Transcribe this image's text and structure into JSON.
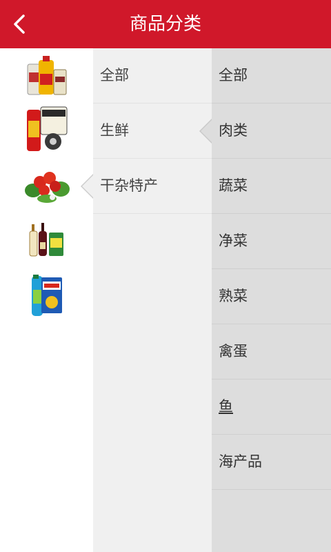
{
  "header": {
    "title": "商品分类",
    "accent": "#d0182a"
  },
  "sidebar": {
    "icons": [
      "oil-rice-products-icon",
      "snacks-drinks-icon",
      "vegetables-icon",
      "liquor-drinks-icon",
      "detergent-products-icon"
    ]
  },
  "middle": {
    "items": [
      {
        "label": "全部"
      },
      {
        "label": "生鲜",
        "selected": true
      },
      {
        "label": "干杂特产"
      }
    ]
  },
  "right": {
    "items": [
      {
        "label": "全部"
      },
      {
        "label": "肉类",
        "selected": true
      },
      {
        "label": "蔬菜"
      },
      {
        "label": "净菜"
      },
      {
        "label": "熟菜"
      },
      {
        "label": "禽蛋"
      },
      {
        "label": "鱼"
      },
      {
        "label": "海产品"
      }
    ]
  }
}
